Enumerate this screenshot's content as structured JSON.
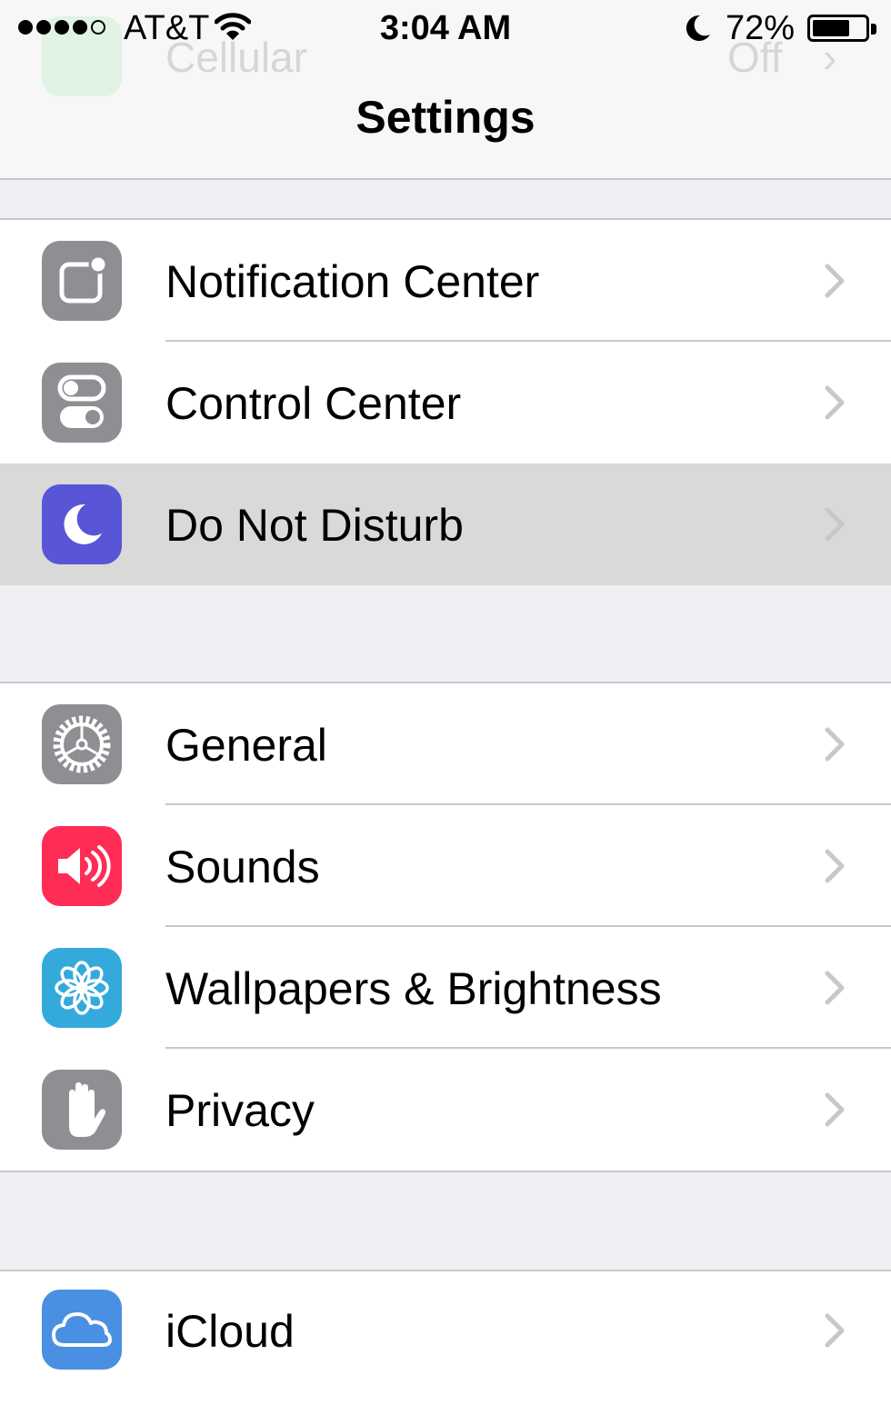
{
  "status_bar": {
    "carrier": "AT&T",
    "time": "3:04 AM",
    "battery_percent": "72%",
    "battery_level": 0.72,
    "signal_bars_filled": 4,
    "signal_bars_total": 5
  },
  "background_row": {
    "label": "Cellular",
    "value": "Off",
    "icon": "cellular-icon"
  },
  "nav": {
    "title": "Settings"
  },
  "groups": [
    {
      "items": [
        {
          "label": "Notification Center",
          "icon": "notification-center-icon",
          "color": "#8e8e93"
        },
        {
          "label": "Control Center",
          "icon": "control-center-icon",
          "color": "#8e8e93"
        },
        {
          "label": "Do Not Disturb",
          "icon": "moon-icon",
          "color": "#5856d6",
          "highlighted": true
        }
      ]
    },
    {
      "items": [
        {
          "label": "General",
          "icon": "gear-icon",
          "color": "#8e8e93"
        },
        {
          "label": "Sounds",
          "icon": "speaker-icon",
          "color": "#ff2d55"
        },
        {
          "label": "Wallpapers & Brightness",
          "icon": "flower-icon",
          "color": "#34aadc"
        },
        {
          "label": "Privacy",
          "icon": "hand-icon",
          "color": "#8e8e93"
        }
      ]
    },
    {
      "items": [
        {
          "label": "iCloud",
          "icon": "cloud-icon",
          "color": "#4a90e2"
        }
      ]
    }
  ],
  "colors": {
    "background": "#efeff4",
    "highlight": "#d9d9d9",
    "separator": "#c8c7cc",
    "chevron": "#c7c7cc"
  }
}
